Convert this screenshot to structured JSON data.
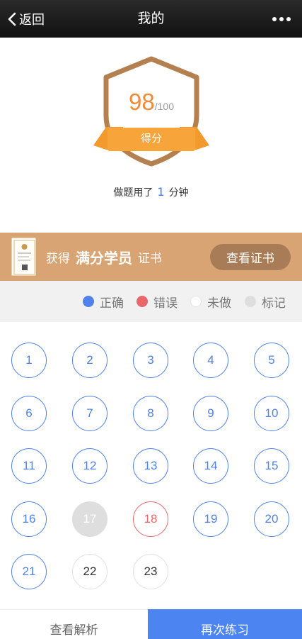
{
  "nav": {
    "back_label": "返回",
    "title": "我的",
    "more_icon": "more-horizontal-icon",
    "back_icon": "chevron-left-icon"
  },
  "score": {
    "value": "98",
    "total": "/100",
    "ribbon_label": "得分",
    "time_prefix": "做题用了",
    "time_value": "1",
    "time_unit": "分钟"
  },
  "certificate": {
    "prefix": "获得",
    "title": "满分学员",
    "suffix": "证书",
    "button_label": "查看证书"
  },
  "legend": [
    {
      "label": "正确",
      "color": "#4f82ea"
    },
    {
      "label": "错误",
      "color": "#e8676a"
    },
    {
      "label": "未做",
      "color": "#ffffff"
    },
    {
      "label": "标记",
      "color": "#dedede"
    }
  ],
  "questions": [
    {
      "num": "1",
      "status": "correct"
    },
    {
      "num": "2",
      "status": "correct"
    },
    {
      "num": "3",
      "status": "correct"
    },
    {
      "num": "4",
      "status": "correct"
    },
    {
      "num": "5",
      "status": "correct"
    },
    {
      "num": "6",
      "status": "correct"
    },
    {
      "num": "7",
      "status": "correct"
    },
    {
      "num": "8",
      "status": "correct"
    },
    {
      "num": "9",
      "status": "correct"
    },
    {
      "num": "10",
      "status": "correct"
    },
    {
      "num": "11",
      "status": "correct"
    },
    {
      "num": "12",
      "status": "correct"
    },
    {
      "num": "13",
      "status": "correct"
    },
    {
      "num": "14",
      "status": "correct"
    },
    {
      "num": "15",
      "status": "correct"
    },
    {
      "num": "16",
      "status": "correct"
    },
    {
      "num": "17",
      "status": "marked"
    },
    {
      "num": "18",
      "status": "wrong"
    },
    {
      "num": "19",
      "status": "correct"
    },
    {
      "num": "20",
      "status": "correct"
    },
    {
      "num": "21",
      "status": "correct"
    },
    {
      "num": "22",
      "status": "undone"
    },
    {
      "num": "23",
      "status": "undone"
    }
  ],
  "bottom": {
    "analysis_label": "查看解析",
    "retry_label": "再次练习"
  },
  "colors": {
    "accent": "#4c84f2",
    "score": "#f08a36",
    "badge": "#b5804f",
    "banner": "#d9a474"
  }
}
